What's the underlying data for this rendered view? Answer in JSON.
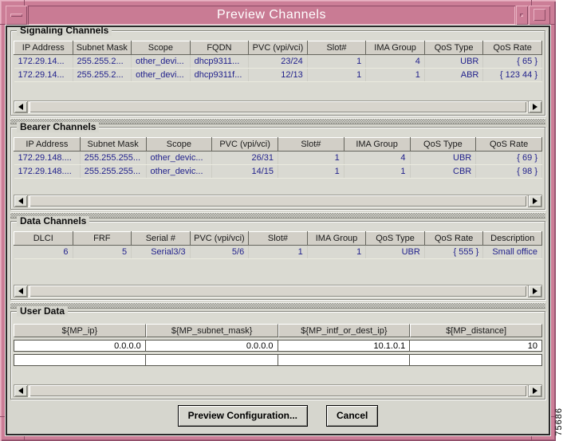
{
  "window": {
    "title": "Preview Channels",
    "figure_number": "75686"
  },
  "sections": {
    "signaling": {
      "title": "Signaling Channels",
      "columns": [
        "IP Address",
        "Subnet Mask",
        "Scope",
        "FQDN",
        "PVC (vpi/vci)",
        "Slot#",
        "IMA Group",
        "QoS Type",
        "QoS Rate"
      ],
      "rows": [
        [
          "172.29.14...",
          "255.255.2...",
          "other_devi...",
          "dhcp9311...",
          "23/24",
          "1",
          "4",
          "UBR",
          "{ 65 }"
        ],
        [
          "172.29.14...",
          "255.255.2...",
          "other_devi...",
          "dhcp9311f...",
          "12/13",
          "1",
          "1",
          "ABR",
          "{ 123 44 }"
        ]
      ]
    },
    "bearer": {
      "title": "Bearer Channels",
      "columns": [
        "IP Address",
        "Subnet Mask",
        "Scope",
        "PVC (vpi/vci)",
        "Slot#",
        "IMA Group",
        "QoS Type",
        "QoS Rate"
      ],
      "rows": [
        [
          "172.29.148....",
          "255.255.255...",
          "other_devic...",
          "26/31",
          "1",
          "4",
          "UBR",
          "{ 69 }"
        ],
        [
          "172.29.148....",
          "255.255.255...",
          "other_devic...",
          "14/15",
          "1",
          "1",
          "CBR",
          "{ 98 }"
        ]
      ]
    },
    "data": {
      "title": "Data Channels",
      "columns": [
        "DLCI",
        "FRF",
        "Serial #",
        "PVC (vpi/vci)",
        "Slot#",
        "IMA Group",
        "QoS Type",
        "QoS Rate",
        "Description"
      ],
      "rows": [
        [
          "6",
          "5",
          "Serial3/3",
          "5/6",
          "1",
          "1",
          "UBR",
          "{ 555 }",
          "Small office"
        ]
      ]
    },
    "user": {
      "title": "User Data",
      "columns": [
        "${MP_ip}",
        "${MP_subnet_mask}",
        "${MP_intf_or_dest_ip}",
        "$[MP_distance]"
      ],
      "rows": [
        [
          "0.0.0.0",
          "0.0.0.0",
          "10.1.0.1",
          "10"
        ],
        [
          "",
          "",
          "",
          ""
        ]
      ]
    }
  },
  "buttons": {
    "preview": "Preview Configuration...",
    "cancel": "Cancel"
  },
  "colors": {
    "title_bar_pink": "#cc7e97",
    "panel_gray": "#d6d6ce",
    "cell_text_blue": "#22228c"
  }
}
